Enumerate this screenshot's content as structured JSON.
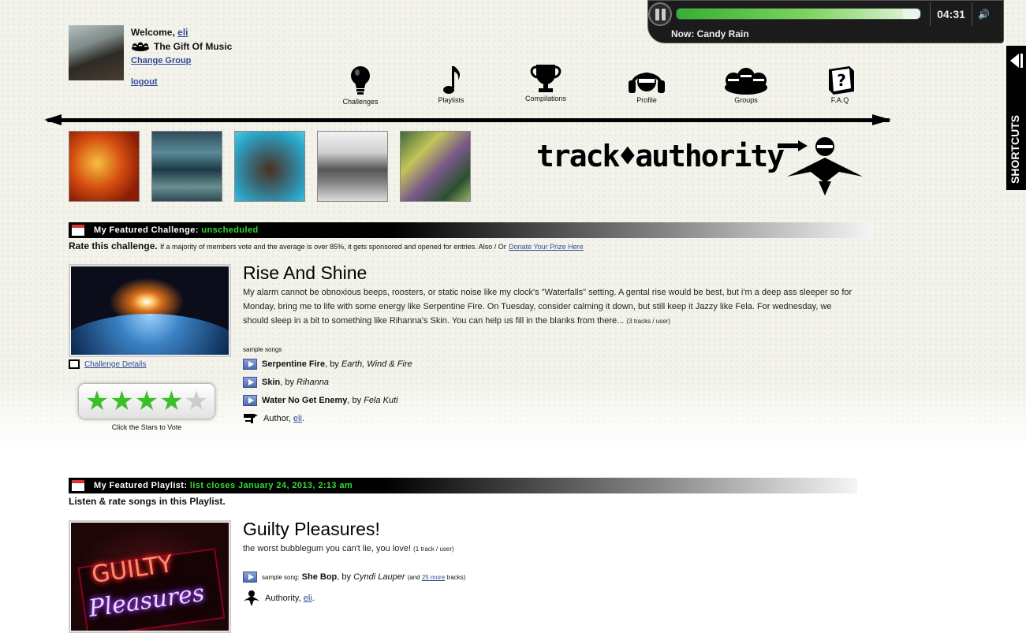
{
  "player": {
    "time": "04:31",
    "now_playing": "Now: Candy Rain",
    "progress": 0.93,
    "volume_icon": "speaker-icon",
    "play_icon": "pause-icon"
  },
  "user": {
    "welcome": "Welcome, ",
    "name": "eli",
    "group": "The Gift Of Music",
    "change_group": "Change Group",
    "logout": "logout"
  },
  "nav": [
    {
      "label": "Challenges",
      "icon": "lightbulb-icon"
    },
    {
      "label": "Playlists",
      "icon": "music-note-icon"
    },
    {
      "label": "Compilations",
      "icon": "trophy-icon"
    },
    {
      "label": "Profile",
      "icon": "headphones-icon"
    },
    {
      "label": "Groups",
      "icon": "group-icon"
    },
    {
      "label": "F.A.Q",
      "icon": "question-box-icon"
    }
  ],
  "brand": "track♦authority",
  "shortcuts": "SHORTCUTS",
  "challenge": {
    "bar_label": "My Featured Challenge:",
    "bar_status": "unscheduled",
    "subtitle": "Rate this challenge.",
    "subtitle_small": "If a majority of members vote and the average is over 85%, it gets sponsored and opened for entries. Also / Or",
    "donate": "Donate Your Prize Here",
    "title": "Rise And Shine",
    "description": "My alarm cannot be obnoxious beeps, roosters, or static noise like my clock's \"Waterfalls\" setting. A gental rise would be best, but i'm a deep ass sleeper so for Monday, bring me to life with some energy like Serpentine Fire. On Tuesday, consider calming it down, but still keep it Jazzy like Fela. For wednesday, we should sleep in a bit to something like Rihanna's Skin. You can help us fill in the blanks from there...",
    "per_user": "(3 tracks / user)",
    "sample_label": "sample songs",
    "songs": [
      {
        "title": "Serpentine Fire",
        "by": ", by ",
        "artist": "Earth, Wind & Fire"
      },
      {
        "title": "Skin",
        "by": ", by ",
        "artist": "Rihanna"
      },
      {
        "title": "Water No Get Enemy",
        "by": ", by ",
        "artist": "Fela Kuti"
      }
    ],
    "author_label": "Author, ",
    "author": "eli",
    "details": "Challenge Details",
    "vote_label": "Click the Stars to Vote",
    "rating": 4,
    "rating_max": 5
  },
  "playlist": {
    "bar_label": "My Featured Playlist:",
    "bar_status": "list closes January 24, 2013, 2:13 am",
    "subtitle": "Listen & rate songs in this Playlist.",
    "title": "Guilty Pleasures!",
    "description": "the worst bubblegum you can't lie, you love!",
    "per_user": "(1 track / user)",
    "sample_label": "sample song:",
    "song_title": "She Bop",
    "song_by": ", by ",
    "song_artist": "Cyndi Lauper",
    "more_pre": "(and ",
    "more_link": "25 more",
    "more_post": " tracks)",
    "authority_label": "Authority, ",
    "authority": "eli",
    "neon_line1": "GUILTY",
    "neon_line2": "Pleasures"
  }
}
